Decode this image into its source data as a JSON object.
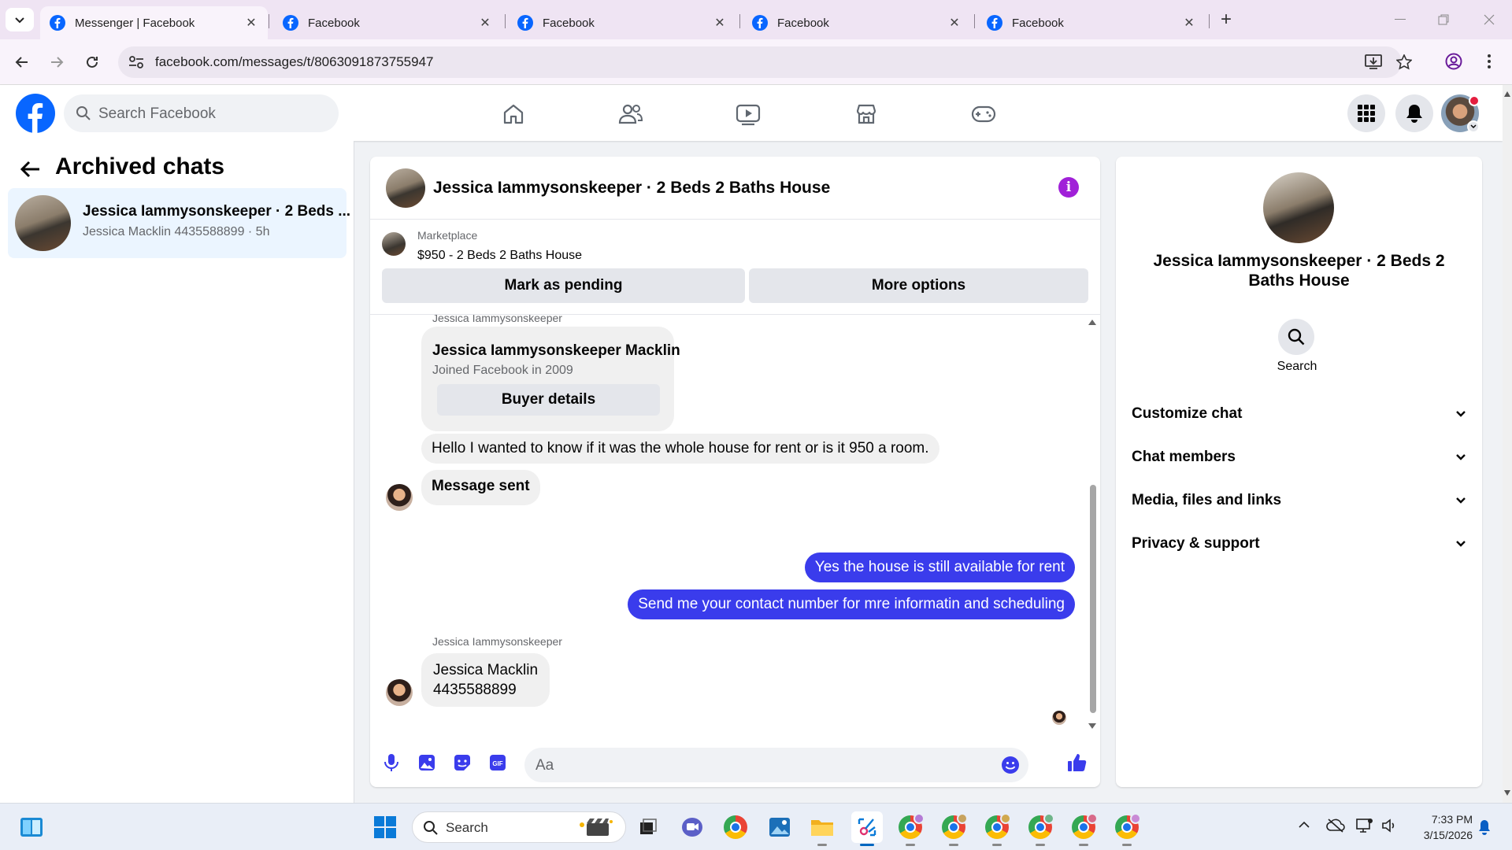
{
  "browser": {
    "tabs": [
      {
        "title": "Messenger | Facebook",
        "active": true
      },
      {
        "title": "Facebook",
        "active": false
      },
      {
        "title": "Facebook",
        "active": false
      },
      {
        "title": "Facebook",
        "active": false
      },
      {
        "title": "Facebook",
        "active": false
      }
    ],
    "url": "facebook.com/messages/t/8063091873755947"
  },
  "fb_header": {
    "search_placeholder": "Search Facebook",
    "nav_icons": [
      "home-icon",
      "friends-icon",
      "video-icon",
      "marketplace-icon",
      "gaming-icon"
    ],
    "brand_color": "#0866ff"
  },
  "left_panel": {
    "title": "Archived chats",
    "chats": [
      {
        "name": "Jessica Iammysonskeeper · 2 Beds ...",
        "preview": "Jessica Macklin 4435588899 · 5h"
      }
    ]
  },
  "conversation": {
    "title": "Jessica Iammysonskeeper · 2 Beds 2 Baths House",
    "marketplace": {
      "label": "Marketplace",
      "listing": "$950 - 2 Beds 2 Baths House",
      "mark_pending": "Mark as pending",
      "more_options": "More options"
    },
    "card": {
      "sender": "Jessica Iammysonskeeper",
      "name": "Jessica Iammysonskeeper Macklin",
      "joined": "Joined Facebook in 2009",
      "button": "Buyer details"
    },
    "messages": [
      {
        "dir": "in",
        "text": "Hello I wanted to know if it was the whole house for rent or is it 950 a room."
      },
      {
        "dir": "in",
        "text": "Message sent"
      },
      {
        "dir": "out",
        "text": "Yes the house is still available for rent"
      },
      {
        "dir": "out",
        "text": "Send me your contact number for mre informatin and  scheduling"
      },
      {
        "dir": "in",
        "sender": "Jessica Iammysonskeeper",
        "text_line1": "Jessica Macklin",
        "text_line2": "4435588899"
      }
    ],
    "composer_placeholder": "Aa",
    "outgoing_color": "#3a3cec",
    "accent_color": "#a020d8"
  },
  "right_panel": {
    "name": "Jessica Iammysonskeeper · 2 Beds 2 Baths House",
    "search_label": "Search",
    "sections": [
      "Customize chat",
      "Chat members",
      "Media, files and links",
      "Privacy & support"
    ]
  },
  "taskbar": {
    "search_placeholder": "Search",
    "time": "7:33 PM",
    "date": "3/15/2026"
  }
}
